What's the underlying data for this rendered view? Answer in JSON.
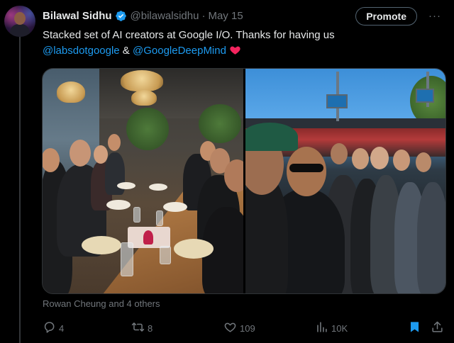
{
  "author": {
    "name": "Bilawal Sidhu",
    "handle": "@bilawalsidhu",
    "separator": "·",
    "date": "May 15",
    "verified_icon": "verified-badge-icon",
    "avatar_icon": "avatar"
  },
  "promote_label": "Promote",
  "more_icon": "more-icon",
  "more_label": "···",
  "tweet": {
    "line1": "Stacked set of AI creators at Google I/O. Thanks for having us",
    "mention1": "@labsdotgoogle",
    "ampersand": " & ",
    "mention2": "@GoogleDeepMind",
    "heart": "❤️"
  },
  "media": {
    "left_photo": "restaurant-group-photo",
    "right_photo": "stadium-selfie-photo"
  },
  "liked_by": "Rowan Cheung and 4 others",
  "actions": {
    "reply_count": "4",
    "repost_count": "8",
    "like_count": "109",
    "views_count": "10K"
  },
  "colors": {
    "background": "#000000",
    "text": "#e7e9ea",
    "secondary": "#71767b",
    "link": "#1d9bf0",
    "heart": "#f91880",
    "bookmark_active": "#1d9bf0"
  },
  "icons": {
    "reply": "reply-icon",
    "repost": "repost-icon",
    "like": "like-icon",
    "views": "views-icon",
    "bookmark": "bookmark-icon",
    "share": "share-icon"
  }
}
